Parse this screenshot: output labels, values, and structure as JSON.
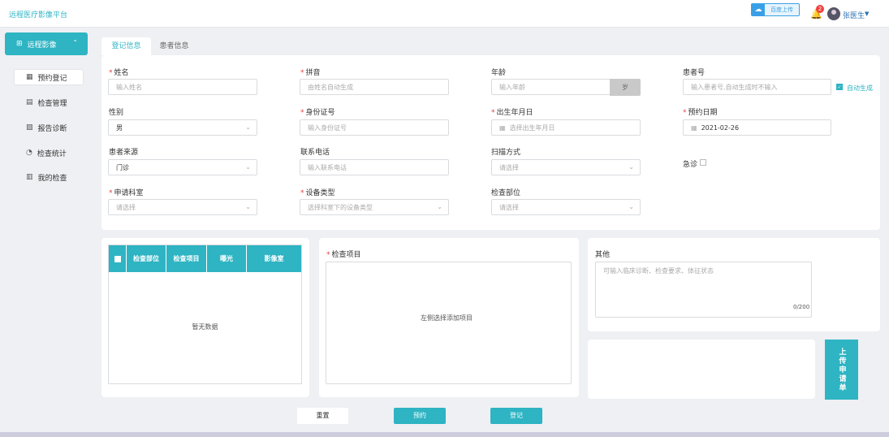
{
  "app": {
    "title": "远程医疗影像平台",
    "upload_label": "百度上传",
    "notification_count": "2",
    "user_name": "张医生"
  },
  "sidebar": {
    "main": "远程影像",
    "items": [
      {
        "label": "预约登记"
      },
      {
        "label": "检查管理"
      },
      {
        "label": "报告诊断"
      },
      {
        "label": "检查统计"
      },
      {
        "label": "我的检查"
      }
    ]
  },
  "tabs": [
    {
      "label": "登记信息"
    },
    {
      "label": "患者信息"
    }
  ],
  "form": {
    "name": {
      "label": "姓名",
      "placeholder": "输入姓名"
    },
    "pinyin": {
      "label": "拼音",
      "placeholder": "由姓名自动生成"
    },
    "age": {
      "label": "年龄",
      "placeholder": "输入年龄",
      "unit": "岁"
    },
    "patient_no": {
      "label": "患者号",
      "placeholder": "输入患者号,自动生成时不输入",
      "auto_label": "自动生成"
    },
    "gender": {
      "label": "性别",
      "value": "男"
    },
    "id_card": {
      "label": "身份证号",
      "placeholder": "输入身份证号"
    },
    "birth": {
      "label": "出生年月日",
      "placeholder": "选择出生年月日"
    },
    "appointment": {
      "label": "预约日期",
      "value": "2021-02-26"
    },
    "source": {
      "label": "患者来源",
      "value": "门诊"
    },
    "phone": {
      "label": "联系电话",
      "placeholder": "输入联系电话"
    },
    "scan": {
      "label": "扫描方式",
      "placeholder": "请选择"
    },
    "urgent": {
      "label": "急诊"
    },
    "department": {
      "label": "申请科室",
      "placeholder": "请选择"
    },
    "device": {
      "label": "设备类型",
      "placeholder": "选择科室下的设备类型"
    },
    "body_part": {
      "label": "检查部位",
      "placeholder": "请选择"
    }
  },
  "table": {
    "columns": [
      "检查部位",
      "检查项目",
      "曝光",
      "影像室"
    ],
    "empty": "暂无数据"
  },
  "items_box": {
    "label": "检查项目",
    "hint": "左侧选择添加项目"
  },
  "other": {
    "label": "其他",
    "placeholder": "可输入临床诊断、检查要求、体征状态",
    "counter": "0/200"
  },
  "buttons": {
    "upload_apply": "上传申请单",
    "reset": "重置",
    "book": "预约",
    "register": "登记"
  }
}
